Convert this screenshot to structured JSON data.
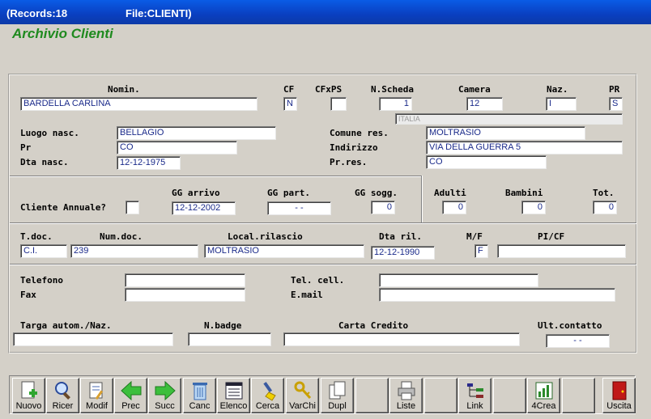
{
  "title_bar": {
    "records": "(Records:18",
    "file": "File:CLIENTI)"
  },
  "app_title": "Archivio Clienti",
  "labels": {
    "nominativo": "Nomin.",
    "cf": "CF",
    "cfxps": "CFxPS",
    "n_scheda": "N.Scheda",
    "camera": "Camera",
    "naz": "Naz.",
    "pr_top": "PR",
    "luogo_nasc": "Luogo nasc.",
    "pr": "Pr",
    "dta_nasc": "Dta nasc.",
    "comune_res": "Comune res.",
    "indirizzo": "Indirizzo",
    "pr_res": "Pr.res.",
    "cliente_annuale": "Cliente Annuale?",
    "gg_arrivo": "GG arrivo",
    "gg_part": "GG part.",
    "gg_sogg": "GG sogg.",
    "adulti": "Adulti",
    "bambini": "Bambini",
    "tot": "Tot.",
    "t_doc": "T.doc.",
    "num_doc": "Num.doc.",
    "local_rilascio": "Local.rilascio",
    "dta_ril": "Dta ril.",
    "mf": "M/F",
    "pi_cf": "PI/CF",
    "telefono": "Telefono",
    "fax": "Fax",
    "tel_cell": "Tel. cell.",
    "email": "E.mail",
    "targa": "Targa autom./Naz.",
    "n_badge": "N.badge",
    "carta_credito": "Carta Credito",
    "ult_contatto": "Ult.contatto"
  },
  "values": {
    "nominativo": "BARDELLA CARLINA",
    "cf": "N",
    "cfxps": "",
    "n_scheda": "1",
    "camera": "12",
    "naz": "I",
    "pr_top": "S",
    "nazione_desc": "ITALIA",
    "luogo_nasc": "BELLAGIO",
    "pr": "CO",
    "dta_nasc": "12-12-1975",
    "comune_res": "MOLTRASIO",
    "indirizzo": "VIA DELLA GUERRA 5",
    "pr_res": "CO",
    "cliente_annuale": "",
    "gg_arrivo": "12-12-2002",
    "gg_part": "  -  -",
    "gg_sogg": "0",
    "adulti": "0",
    "bambini": "0",
    "tot": "0",
    "t_doc": "C.I.",
    "num_doc": "239",
    "local_rilascio": "MOLTRASIO",
    "dta_ril": "12-12-1990",
    "mf": "F",
    "pi_cf": "",
    "telefono": "",
    "fax": "",
    "tel_cell": "",
    "email": "",
    "targa": "",
    "n_badge": "",
    "carta_credito": "",
    "ult_contatto": "  -  -"
  },
  "toolbar": [
    {
      "label": "Nuovo",
      "icon": "new-document-icon"
    },
    {
      "label": "Ricer",
      "icon": "magnifier-icon"
    },
    {
      "label": "Modif",
      "icon": "edit-document-icon"
    },
    {
      "label": "Prec",
      "icon": "arrow-left-icon"
    },
    {
      "label": "Succ",
      "icon": "arrow-right-icon"
    },
    {
      "label": "Canc",
      "icon": "trash-icon"
    },
    {
      "label": "Elenco",
      "icon": "list-icon"
    },
    {
      "label": "Cerca",
      "icon": "brush-icon"
    },
    {
      "label": "VarChi",
      "icon": "keys-icon"
    },
    {
      "label": "Dupl",
      "icon": "duplicate-icon"
    },
    {
      "label": "",
      "icon": ""
    },
    {
      "label": "Liste",
      "icon": "printer-icon"
    },
    {
      "label": "",
      "icon": ""
    },
    {
      "label": "Link",
      "icon": "tree-icon"
    },
    {
      "label": "",
      "icon": ""
    },
    {
      "label": "4Crea",
      "icon": "chart-icon"
    },
    {
      "label": "",
      "icon": ""
    },
    {
      "label": "Uscita",
      "icon": "exit-door-icon"
    }
  ]
}
